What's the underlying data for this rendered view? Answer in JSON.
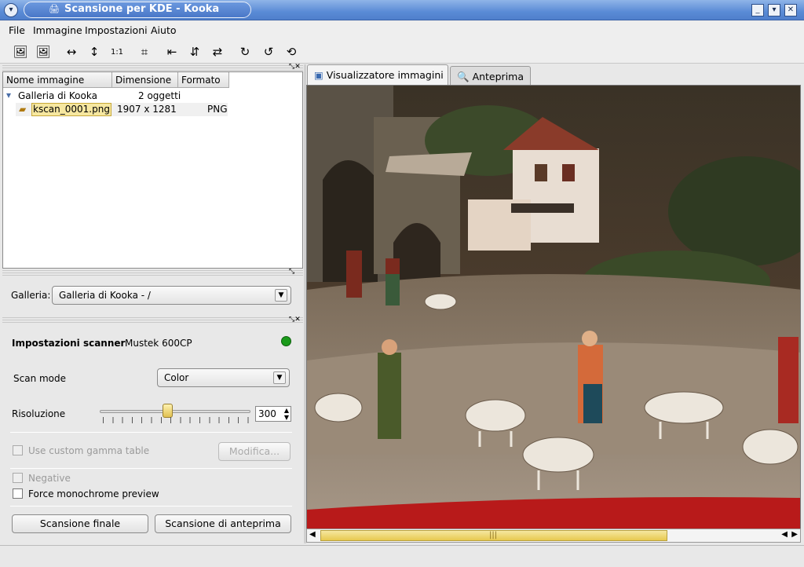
{
  "window": {
    "title": "Scansione per KDE - Kooka"
  },
  "menu": {
    "file": "File",
    "image": "Immagine",
    "settings": "Impostazioni",
    "help": "Aiuto"
  },
  "gallery": {
    "columns": [
      "Nome immagine",
      "Dimensione",
      "Formato"
    ],
    "root": {
      "name": "Galleria di Kooka",
      "size": "2 oggetti",
      "format": ""
    },
    "items": [
      {
        "name": "kscan_0001.png",
        "size": "1907 x 1281",
        "format": "PNG"
      }
    ]
  },
  "gallery_select": {
    "label": "Galleria:",
    "value": "Galleria di Kooka - /"
  },
  "scanner": {
    "header_bold": "Impostazioni scanner",
    "device": "Mustek 600CP",
    "status_color": "#1a9a1a",
    "scan_mode_label": "Scan mode",
    "scan_mode_value": "Color",
    "resolution_label": "Risoluzione",
    "resolution_value": "300",
    "gamma_label": "Use custom gamma table",
    "gamma_button": "Modifica...",
    "negative_label": "Negative",
    "mono_label": "Force monochrome preview",
    "final_scan_button": "Scansione finale",
    "preview_scan_button": "Scansione di anteprima"
  },
  "tabs": [
    {
      "label": "Visualizzatore immagini",
      "active": true,
      "icon": "image-viewer-icon"
    },
    {
      "label": "Anteprima",
      "active": false,
      "icon": "magnifier-icon"
    }
  ],
  "colors": {
    "title_bar": "#5a8bd6",
    "selection": "#f6e7a0"
  }
}
